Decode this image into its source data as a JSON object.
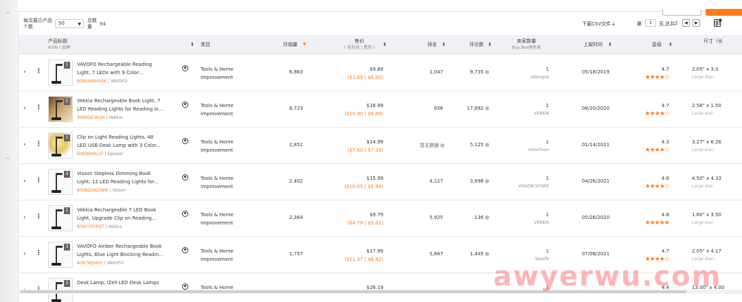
{
  "toolbar": {
    "per_page_label": "每页展示产品个数",
    "per_page_value": "50",
    "total_label": "总数量",
    "total_value": "94",
    "download_label": "下载CSV文件",
    "page_prefix": "第",
    "page_value": "1",
    "page_suffix": "页,总共",
    "page_total": "2"
  },
  "headers": {
    "product_title": "产品标题",
    "product_sub": "ASIN | 品牌",
    "category": "类目",
    "monthly_sales": "月销量",
    "price": "售价",
    "price_sub": "( 毛利润 | 费用 )",
    "rank": "排名",
    "reviews": "评论数",
    "sellers": "卖家数量",
    "sellers_sub": "Buy Box拥有者",
    "launch_date": "上架时间",
    "rating": "星级",
    "size": "尺寸（长"
  },
  "rows": [
    {
      "thumb_num": "1",
      "thumb_style": "lamp",
      "title1": "VAVOFO Rechargeable Reading",
      "title2": "Light, 7 LEDs with 9 Color...",
      "asin": "B095WW4V5K",
      "brand": "VAVOFO",
      "category1": "Tools & Home",
      "category2": "Improvement",
      "sales": "6,863",
      "price": "$9.89",
      "fees": "($3.89 | $6.00)",
      "rank": "1,047",
      "reviews": "9,735",
      "sellers": "1",
      "bb": "zelongus",
      "date": "05/18/2019",
      "rating": "4.7",
      "stars": "★★★★☆",
      "size": "2.05\" x 3.0",
      "tier": "Large stan"
    },
    {
      "thumb_num": "5",
      "thumb_style": "photo",
      "title1": "Vekkia Rechargeable Book Light, 7",
      "title2": "LED Reading Lights for Reading in...",
      "asin": "B0982JCWQH",
      "brand": "Vekkia",
      "category1": "Tools & Home",
      "category2": "Improvement",
      "sales": "6,723",
      "price": "$16.99",
      "fees": "($10.90 | $6.09)",
      "rank": "656",
      "reviews": "17,892",
      "sellers": "1",
      "bb": "VEKKIA",
      "date": "08/20/2020",
      "rating": "4.7",
      "stars": "★★★★☆",
      "size": "2.56\" x 1.50",
      "tier": "Large stan"
    },
    {
      "thumb_num": "1",
      "thumb_style": "warm",
      "title1": "Clip on Light Reading Lights, 48",
      "title2": "LED USB Desk Lamp with 3 Color...",
      "asin": "B08WJHRLSF",
      "brand": "Dpower",
      "category1": "Tools & Home",
      "category2": "Improvement",
      "sales": "2,851",
      "price": "$14.99",
      "fees": "($7.60 | $7.39)",
      "rank": "暂无数据",
      "reviews": "5,125",
      "sellers": "1",
      "bb": "mirechuin",
      "date": "01/14/2021",
      "rating": "4.3",
      "stars": "★★★★☆",
      "size": "3.27\" x 6.26",
      "tier": "Large stan"
    },
    {
      "thumb_num": "4",
      "thumb_style": "lamp",
      "title1": "Visson Stepless Dimming Book",
      "title2": "Light, 12 LED Reading Lights for...",
      "asin": "B0982GWZWW",
      "brand": "Visson",
      "category1": "Tools & Home",
      "category2": "Improvement",
      "sales": "2,402",
      "price": "$15.99",
      "fees": "($10.05 | $5.94)",
      "rank": "4,127",
      "reviews": "3,896",
      "sellers": "1",
      "bb": "VISSON STORE",
      "date": "04/26/2021",
      "rating": "4.6",
      "stars": "★★★★☆",
      "size": "4.50\" x 4.33",
      "tier": "Large stan"
    },
    {
      "thumb_num": "1",
      "thumb_style": "lamp",
      "title1": "Vekkia Rechargeable 7 LED Book",
      "title2": "Light, Upgrade Clip on Reading...",
      "asin": "B092YZVKQT",
      "brand": "Vekkia",
      "category1": "Tools & Home",
      "category2": "Improvement",
      "sales": "2,364",
      "price": "$9.79",
      "fees": "($4.78 | $5.01)",
      "rank": "5,925",
      "reviews": "136",
      "sellers": "1",
      "bb": "VEKKIA",
      "date": "05/26/2020",
      "rating": "4.8",
      "stars": "★★★★★",
      "size": "1.60\" x 3.50",
      "tier": "Large stan"
    },
    {
      "thumb_num": "3",
      "thumb_style": "lamp",
      "title1": "VAVOFO Amber Rechargeable Book",
      "title2": "Lights, Blue Light Blocking Readin...",
      "asin": "B097NJS4H1",
      "brand": "VAVOFO",
      "category1": "Tools & Home",
      "category2": "Improvement",
      "sales": "1,757",
      "price": "$17.99",
      "fees": "($11.37 | $6.62)",
      "rank": "5,667",
      "reviews": "1,445",
      "sellers": "1",
      "bb": "Vavofo",
      "date": "07/08/2021",
      "rating": "4.7",
      "stars": "★★★★☆",
      "size": "2.05\" x 4.17",
      "tier": "Large stan"
    },
    {
      "thumb_num": "2",
      "thumb_style": "lamp",
      "title1": "Desk Lamp, iZell LED Desk Lamps",
      "title2": "",
      "asin": "",
      "brand": "",
      "category1": "Tools & Home",
      "category2": "",
      "sales": "",
      "price": "$26.19",
      "fees": "",
      "rank": "",
      "reviews": "",
      "sellers": "1",
      "bb": "",
      "date": "",
      "rating": "4.4",
      "stars": "",
      "size": "13.00\" x 4.00",
      "tier": ""
    }
  ],
  "watermark": "awyerwu.com"
}
